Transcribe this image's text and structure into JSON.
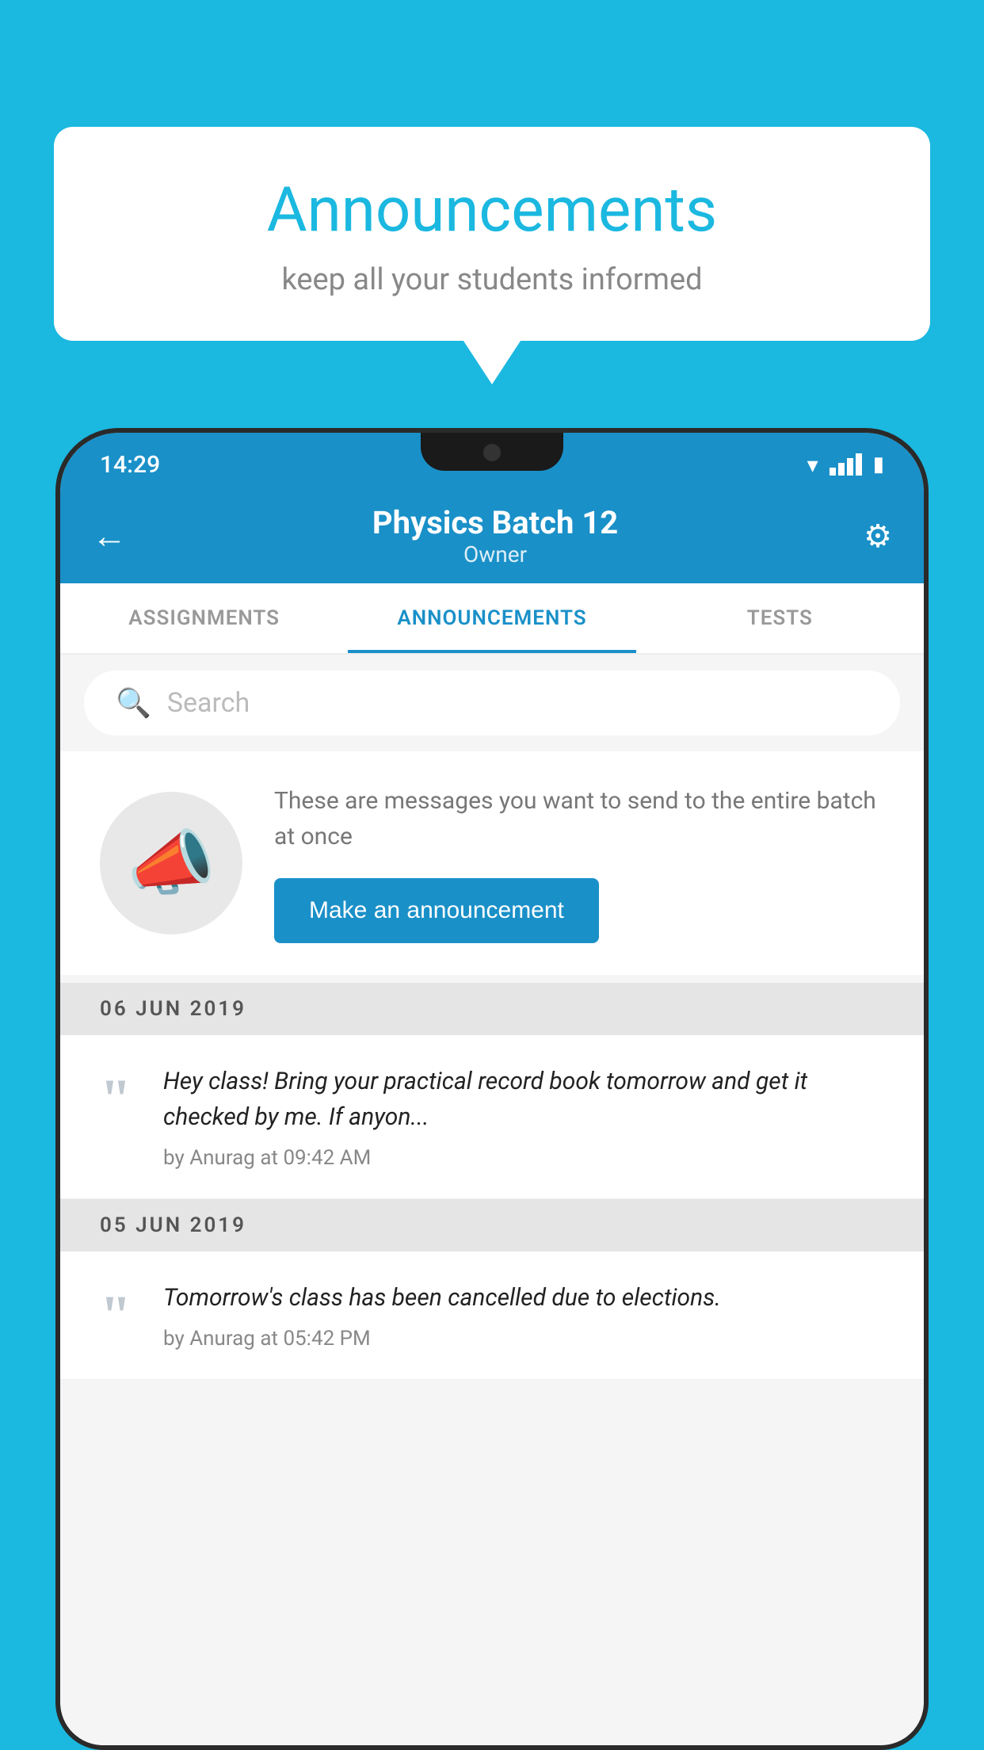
{
  "background_color": "#1bb8e0",
  "bubble": {
    "title": "Announcements",
    "subtitle": "keep all your students informed"
  },
  "status_bar": {
    "time": "14:29"
  },
  "header": {
    "title": "Physics Batch 12",
    "subtitle": "Owner",
    "back_label": "←",
    "settings_label": "⚙"
  },
  "tabs": [
    {
      "label": "ASSIGNMENTS",
      "active": false
    },
    {
      "label": "ANNOUNCEMENTS",
      "active": true
    },
    {
      "label": "TESTS",
      "active": false
    }
  ],
  "search": {
    "placeholder": "Search"
  },
  "announcement_prompt": {
    "description": "These are messages you want to send to the entire batch at once",
    "button_label": "Make an announcement"
  },
  "date_groups": [
    {
      "date": "06  JUN  2019",
      "items": [
        {
          "text": "Hey class! Bring your practical record book tomorrow and get it checked by me. If anyon...",
          "meta": "by Anurag at 09:42 AM"
        }
      ]
    },
    {
      "date": "05  JUN  2019",
      "items": [
        {
          "text": "Tomorrow's class has been cancelled due to elections.",
          "meta": "by Anurag at 05:42 PM"
        }
      ]
    }
  ]
}
